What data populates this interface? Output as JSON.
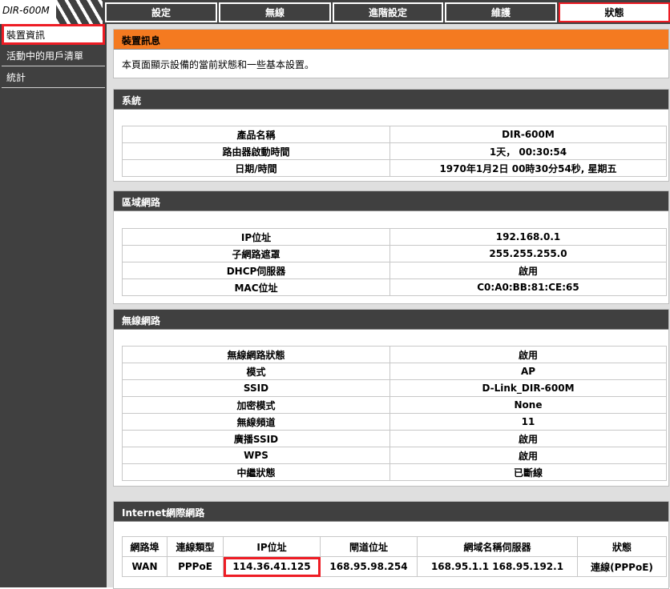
{
  "header": {
    "logo": "DIR-600M",
    "tabs": [
      {
        "label": "設定"
      },
      {
        "label": "無線"
      },
      {
        "label": "進階設定"
      },
      {
        "label": "維護"
      },
      {
        "label": "狀態"
      }
    ]
  },
  "sidebar": {
    "items": [
      {
        "label": "裝置資訊"
      },
      {
        "label": "活動中的用戶清單"
      },
      {
        "label": "統計"
      }
    ]
  },
  "device_info": {
    "title": "裝置訊息",
    "description": "本頁面顯示設備的當前狀態和一些基本設置。"
  },
  "system": {
    "title": "系統",
    "rows": [
      {
        "key": "產品名稱",
        "value": "DIR-600M"
      },
      {
        "key": "路由器啟動時間",
        "value": "1天， 00:30:54"
      },
      {
        "key": "日期/時間",
        "value": "1970年1月2日 00時30分54秒, 星期五"
      }
    ]
  },
  "lan": {
    "title": "區域網路",
    "rows": [
      {
        "key": "IP位址",
        "value": "192.168.0.1"
      },
      {
        "key": "子網路遮罩",
        "value": "255.255.255.0"
      },
      {
        "key": "DHCP伺服器",
        "value": "啟用"
      },
      {
        "key": "MAC位址",
        "value": "C0:A0:BB:81:CE:65"
      }
    ]
  },
  "wireless": {
    "title": "無線網路",
    "rows": [
      {
        "key": "無線網路狀態",
        "value": "啟用"
      },
      {
        "key": "模式",
        "value": "AP"
      },
      {
        "key": "SSID",
        "value": "D-Link_DIR-600M"
      },
      {
        "key": "加密模式",
        "value": "None"
      },
      {
        "key": "無線頻道",
        "value": "11"
      },
      {
        "key": "廣播SSID",
        "value": "啟用"
      },
      {
        "key": "WPS",
        "value": "啟用"
      },
      {
        "key": "中繼狀態",
        "value": "已斷線"
      }
    ]
  },
  "internet": {
    "title": "Internet網際網路",
    "headers": [
      "網路埠",
      "連線類型",
      "IP位址",
      "閘道位址",
      "網域名稱伺服器",
      "狀態"
    ],
    "row": [
      "WAN",
      "PPPoE",
      "114.36.41.125",
      "168.95.98.254",
      "168.95.1.1 168.95.192.1",
      "連線(PPPoE)"
    ]
  },
  "colors": {
    "accent_orange": "#f47a20",
    "dark": "#404040",
    "highlight_red": "#ee1c24"
  }
}
